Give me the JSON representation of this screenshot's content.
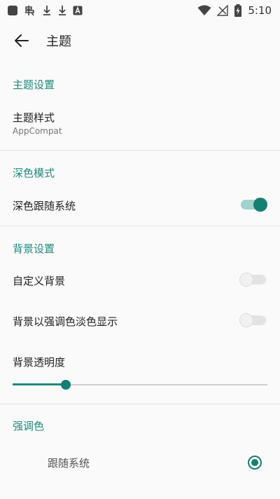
{
  "status_bar": {
    "time": "5:10",
    "icons_left": [
      "app-square-icon",
      "notification-icon",
      "download-icon",
      "download-icon",
      "app-a-icon"
    ],
    "icons_right": [
      "wifi-icon",
      "no-signal-icon",
      "battery-charging-icon"
    ]
  },
  "appbar": {
    "title": "主题"
  },
  "sections": {
    "theme": {
      "header": "主题设置",
      "style_title": "主题样式",
      "style_value": "AppCompat"
    },
    "dark": {
      "header": "深色模式",
      "follow_system_label": "深色跟随系统",
      "follow_system_on": true
    },
    "background": {
      "header": "背景设置",
      "custom_bg_label": "自定义背景",
      "custom_bg_on": false,
      "accent_tint_label": "背景以强调色淡色显示",
      "accent_tint_on": false,
      "opacity_label": "背景透明度",
      "opacity_value": 0.21
    },
    "accent": {
      "header": "强调色",
      "follow_system_label": "跟随系统",
      "follow_system_selected": true
    }
  },
  "colors": {
    "accent": "#1f8b7d",
    "accent_dark": "#157f72",
    "switch_track_on": "#9ed4cc"
  }
}
